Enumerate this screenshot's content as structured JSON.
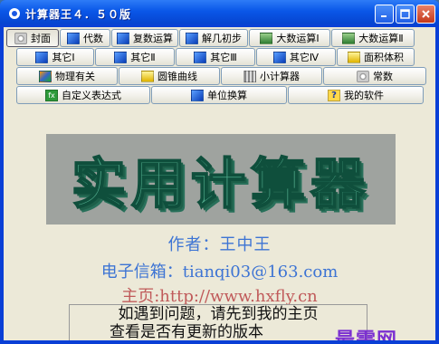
{
  "window": {
    "title": "计算器王４．５０版"
  },
  "toolbar": {
    "row1": [
      {
        "label": "封面",
        "icon": "camera-icon"
      },
      {
        "label": "代数",
        "icon": "algebra-icon"
      },
      {
        "label": "复数运算",
        "icon": "complex-icon"
      },
      {
        "label": "解几初步",
        "icon": "geometry-icon"
      },
      {
        "label": "大数运算Ⅰ",
        "icon": "bignum-icon"
      },
      {
        "label": "大数运算Ⅱ",
        "icon": "bignum-icon"
      }
    ],
    "row2": [
      {
        "label": "其它Ⅰ",
        "icon": "other-icon"
      },
      {
        "label": "其它Ⅱ",
        "icon": "other-icon"
      },
      {
        "label": "其它Ⅲ",
        "icon": "other-icon"
      },
      {
        "label": "其它Ⅳ",
        "icon": "other-icon"
      },
      {
        "label": "面积体积",
        "icon": "area-icon"
      }
    ],
    "row3": [
      {
        "label": "物理有关",
        "icon": "physics-icon"
      },
      {
        "label": "圆锥曲线",
        "icon": "conic-icon"
      },
      {
        "label": "小计算器",
        "icon": "calculator-icon"
      },
      {
        "label": "常数",
        "icon": "constant-icon"
      }
    ],
    "row4": [
      {
        "label": "自定义表达式",
        "icon": "fx-icon"
      },
      {
        "label": "单位换算",
        "icon": "unit-icon"
      },
      {
        "label": "我的软件",
        "icon": "help-icon"
      }
    ]
  },
  "content": {
    "banner": "实用计算器",
    "author": "作者：王中王",
    "email": "电子信箱：tianqi03@163.com",
    "homepage": "主页:http://www.hxfly.cn",
    "note_line1": "如遇到问题，请先到我的主页",
    "note_line2": "查看是否有更新的版本",
    "watermark": "最需网"
  },
  "colors": {
    "titlebar": "#0a57e8",
    "client": "#ece9d8",
    "author": "#3d74d4",
    "homepage": "#c05a5a",
    "watermark": "#7b2fd1"
  }
}
